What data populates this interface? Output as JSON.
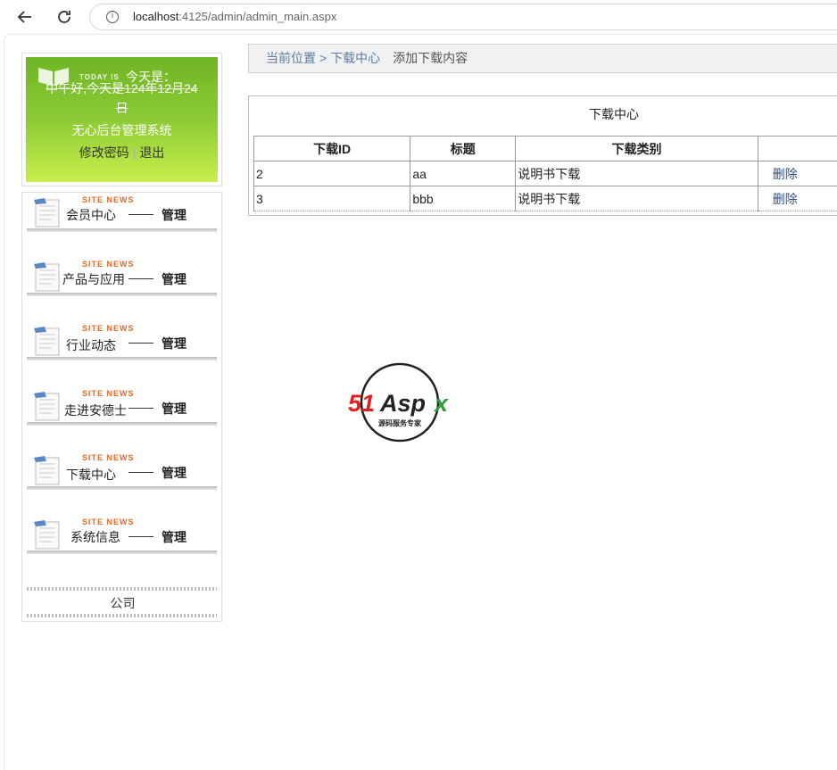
{
  "browser": {
    "url_host": "localhost",
    "url_path": ":4125/admin/admin_main.aspx",
    "back_icon": "arrow-left-icon",
    "reload_icon": "reload-icon",
    "info_icon": "info-icon"
  },
  "sidebar": {
    "today_small": "TODAY IS",
    "today_big": "今天是：",
    "greeting_line1": "中午好,今天是124年12月24",
    "greeting_line2": "日",
    "system_name": "无心后台管理系统",
    "change_password": "修改密码",
    "separator": "|",
    "logout": "退出",
    "site_news": "SITE NEWS",
    "dash": "——",
    "manage": "管理",
    "menu": [
      {
        "label": "会员中心"
      },
      {
        "label": "产品与应用"
      },
      {
        "label": "行业动态"
      },
      {
        "label": "走进安德士"
      },
      {
        "label": "下载中心"
      },
      {
        "label": "系统信息"
      }
    ],
    "company": "公司"
  },
  "breadcrumb": {
    "current_position": "当前位置",
    "arrow": ">",
    "section": "下载中心",
    "add_link": "添加下载内容"
  },
  "panel": {
    "title": "下载中心",
    "columns": [
      "下载ID",
      "标题",
      "下载类别",
      ""
    ],
    "rows": [
      {
        "id": "2",
        "title": "aa",
        "category": "说明书下载",
        "action": "删除"
      },
      {
        "id": "3",
        "title": "bbb",
        "category": "说明书下载",
        "action": "删除"
      }
    ]
  },
  "watermark": {
    "brand": "51Aspx",
    "tagline": "源码服务专家"
  },
  "colors": {
    "sidebar_green_top": "#6fb424",
    "sidebar_green_bottom": "#c8ef4a",
    "link_blue": "#5a7ca3",
    "site_news_orange": "#e06a2a"
  }
}
